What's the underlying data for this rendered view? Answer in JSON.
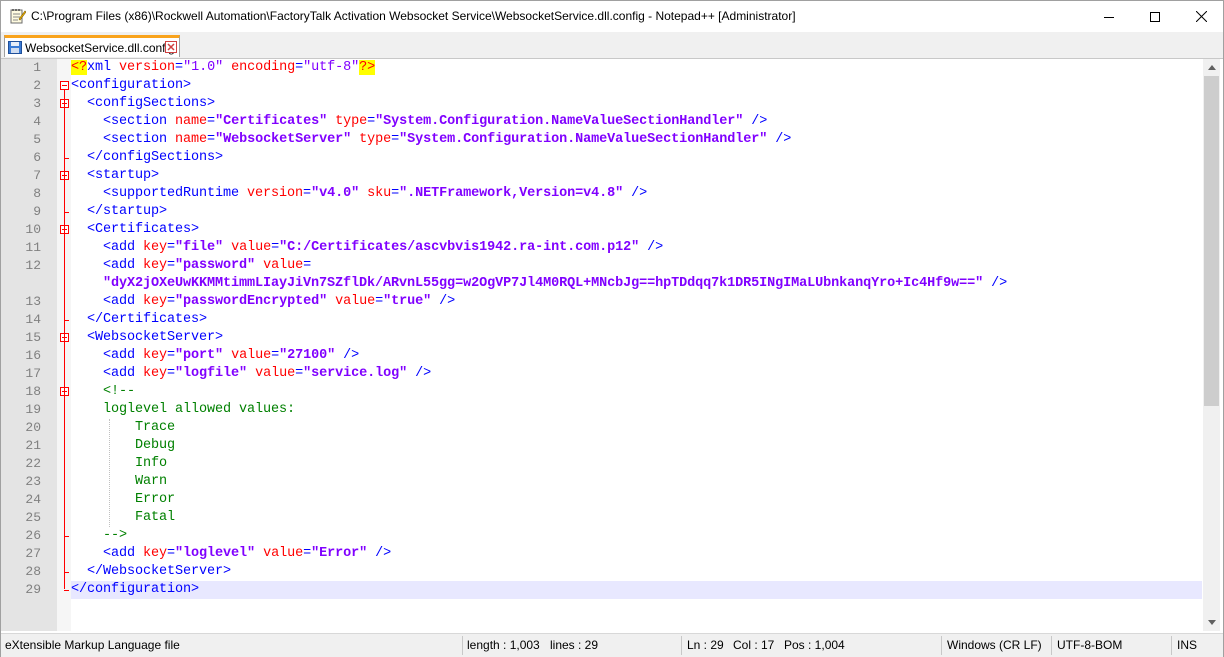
{
  "window": {
    "title": "C:\\Program Files (x86)\\Rockwell Automation\\FactoryTalk Activation Websocket Service\\WebsocketService.dll.config - Notepad++ [Administrator]"
  },
  "tabs": [
    {
      "label": "WebsocketService.dll.config"
    }
  ],
  "editor": {
    "line_numbers": [
      "1",
      "2",
      "3",
      "4",
      "5",
      "6",
      "7",
      "8",
      "9",
      "10",
      "11",
      "12",
      "13",
      "14",
      "15",
      "16",
      "17",
      "18",
      "19",
      "20",
      "21",
      "22",
      "23",
      "24",
      "25",
      "26",
      "27",
      "28",
      "29"
    ],
    "current_line": 29
  },
  "statusbar": {
    "file_type": "eXtensible Markup Language file",
    "length": "length : 1,003",
    "lines": "lines : 29",
    "ln": "Ln : 29",
    "col": "Col : 17",
    "pos": "Pos : 1,004",
    "eol": "Windows (CR LF)",
    "encoding": "UTF-8-BOM",
    "mode": "INS"
  },
  "icons": {
    "app": "notepad-plus-plus-icon",
    "tab_doc": "saved-document-icon",
    "tab_close": "close-tab-icon",
    "minimize": "minimize-icon",
    "maximize": "maximize-icon",
    "close": "close-icon"
  },
  "code_lines": [
    [
      [
        "pi",
        "<?"
      ],
      [
        "t",
        "xml "
      ],
      [
        "a",
        "version"
      ],
      [
        "t",
        "="
      ],
      [
        "v2",
        "\"1.0\""
      ],
      [
        "t",
        " "
      ],
      [
        "a",
        "encoding"
      ],
      [
        "t",
        "="
      ],
      [
        "v2",
        "\"utf-8\""
      ],
      [
        "pi",
        "?>"
      ]
    ],
    [
      [
        "t",
        "<configuration>"
      ]
    ],
    [
      [
        "t",
        "  <configSections>"
      ]
    ],
    [
      [
        "t",
        "    <section "
      ],
      [
        "a",
        "name"
      ],
      [
        "t",
        "="
      ],
      [
        "v",
        "\"Certificates\""
      ],
      [
        "t",
        " "
      ],
      [
        "a",
        "type"
      ],
      [
        "t",
        "="
      ],
      [
        "v",
        "\"System.Configuration.NameValueSectionHandler\""
      ],
      [
        "t",
        " />"
      ]
    ],
    [
      [
        "t",
        "    <section "
      ],
      [
        "a",
        "name"
      ],
      [
        "t",
        "="
      ],
      [
        "v",
        "\"WebsocketServer\""
      ],
      [
        "t",
        " "
      ],
      [
        "a",
        "type"
      ],
      [
        "t",
        "="
      ],
      [
        "v",
        "\"System.Configuration.NameValueSectionHandler\""
      ],
      [
        "t",
        " />"
      ]
    ],
    [
      [
        "t",
        "  </configSections>"
      ]
    ],
    [
      [
        "t",
        "  <startup>"
      ]
    ],
    [
      [
        "t",
        "    <supportedRuntime "
      ],
      [
        "a",
        "version"
      ],
      [
        "t",
        "="
      ],
      [
        "v",
        "\"v4.0\""
      ],
      [
        "t",
        " "
      ],
      [
        "a",
        "sku"
      ],
      [
        "t",
        "="
      ],
      [
        "v",
        "\".NETFramework,Version=v4.8\""
      ],
      [
        "t",
        " />"
      ]
    ],
    [
      [
        "t",
        "  </startup>"
      ]
    ],
    [
      [
        "t",
        "  <Certificates>"
      ]
    ],
    [
      [
        "t",
        "    <add "
      ],
      [
        "a",
        "key"
      ],
      [
        "t",
        "="
      ],
      [
        "v",
        "\"file\""
      ],
      [
        "t",
        " "
      ],
      [
        "a",
        "value"
      ],
      [
        "t",
        "="
      ],
      [
        "v",
        "\"C:/Certificates/ascvbvis1942.ra-int.com.p12\""
      ],
      [
        "t",
        " />"
      ]
    ],
    [
      [
        "t",
        "    <add "
      ],
      [
        "a",
        "key"
      ],
      [
        "t",
        "="
      ],
      [
        "v",
        "\"password\""
      ],
      [
        "t",
        " "
      ],
      [
        "a",
        "value"
      ],
      [
        "t",
        "="
      ]
    ],
    [
      [
        "v",
        "    \"dyX2jOXeUwKKMMtimmLIayJiVn7SZflDk/ARvnL55gg=w2OgVP7Jl4M0RQL+MNcbJg==hpTDdqq7k1DR5INgIMaLUbnkanqYro+Ic4Hf9w==\""
      ],
      [
        "t",
        " />"
      ]
    ],
    [
      [
        "t",
        "    <add "
      ],
      [
        "a",
        "key"
      ],
      [
        "t",
        "="
      ],
      [
        "v",
        "\"passwordEncrypted\""
      ],
      [
        "t",
        " "
      ],
      [
        "a",
        "value"
      ],
      [
        "t",
        "="
      ],
      [
        "v",
        "\"true\""
      ],
      [
        "t",
        " />"
      ]
    ],
    [
      [
        "t",
        "  </Certificates>"
      ]
    ],
    [
      [
        "t",
        "  <WebsocketServer>"
      ]
    ],
    [
      [
        "t",
        "    <add "
      ],
      [
        "a",
        "key"
      ],
      [
        "t",
        "="
      ],
      [
        "v",
        "\"port\""
      ],
      [
        "t",
        " "
      ],
      [
        "a",
        "value"
      ],
      [
        "t",
        "="
      ],
      [
        "v",
        "\"27100\""
      ],
      [
        "t",
        " />"
      ]
    ],
    [
      [
        "t",
        "    <add "
      ],
      [
        "a",
        "key"
      ],
      [
        "t",
        "="
      ],
      [
        "v",
        "\"logfile\""
      ],
      [
        "t",
        " "
      ],
      [
        "a",
        "value"
      ],
      [
        "t",
        "="
      ],
      [
        "v",
        "\"service.log\""
      ],
      [
        "t",
        " />"
      ]
    ],
    [
      [
        "c",
        "    <!--"
      ]
    ],
    [
      [
        "c",
        "    loglevel allowed values:"
      ]
    ],
    [
      [
        "c",
        "        Trace"
      ]
    ],
    [
      [
        "c",
        "        Debug"
      ]
    ],
    [
      [
        "c",
        "        Info"
      ]
    ],
    [
      [
        "c",
        "        Warn"
      ]
    ],
    [
      [
        "c",
        "        Error"
      ]
    ],
    [
      [
        "c",
        "        Fatal"
      ]
    ],
    [
      [
        "c",
        "    -->"
      ]
    ],
    [
      [
        "t",
        "    <add "
      ],
      [
        "a",
        "key"
      ],
      [
        "t",
        "="
      ],
      [
        "v",
        "\"loglevel\""
      ],
      [
        "t",
        " "
      ],
      [
        "a",
        "value"
      ],
      [
        "t",
        "="
      ],
      [
        "v",
        "\"Error\""
      ],
      [
        "t",
        " />"
      ]
    ],
    [
      [
        "t",
        "  </WebsocketServer>"
      ]
    ],
    [
      [
        "t",
        "</configuration>"
      ]
    ]
  ]
}
